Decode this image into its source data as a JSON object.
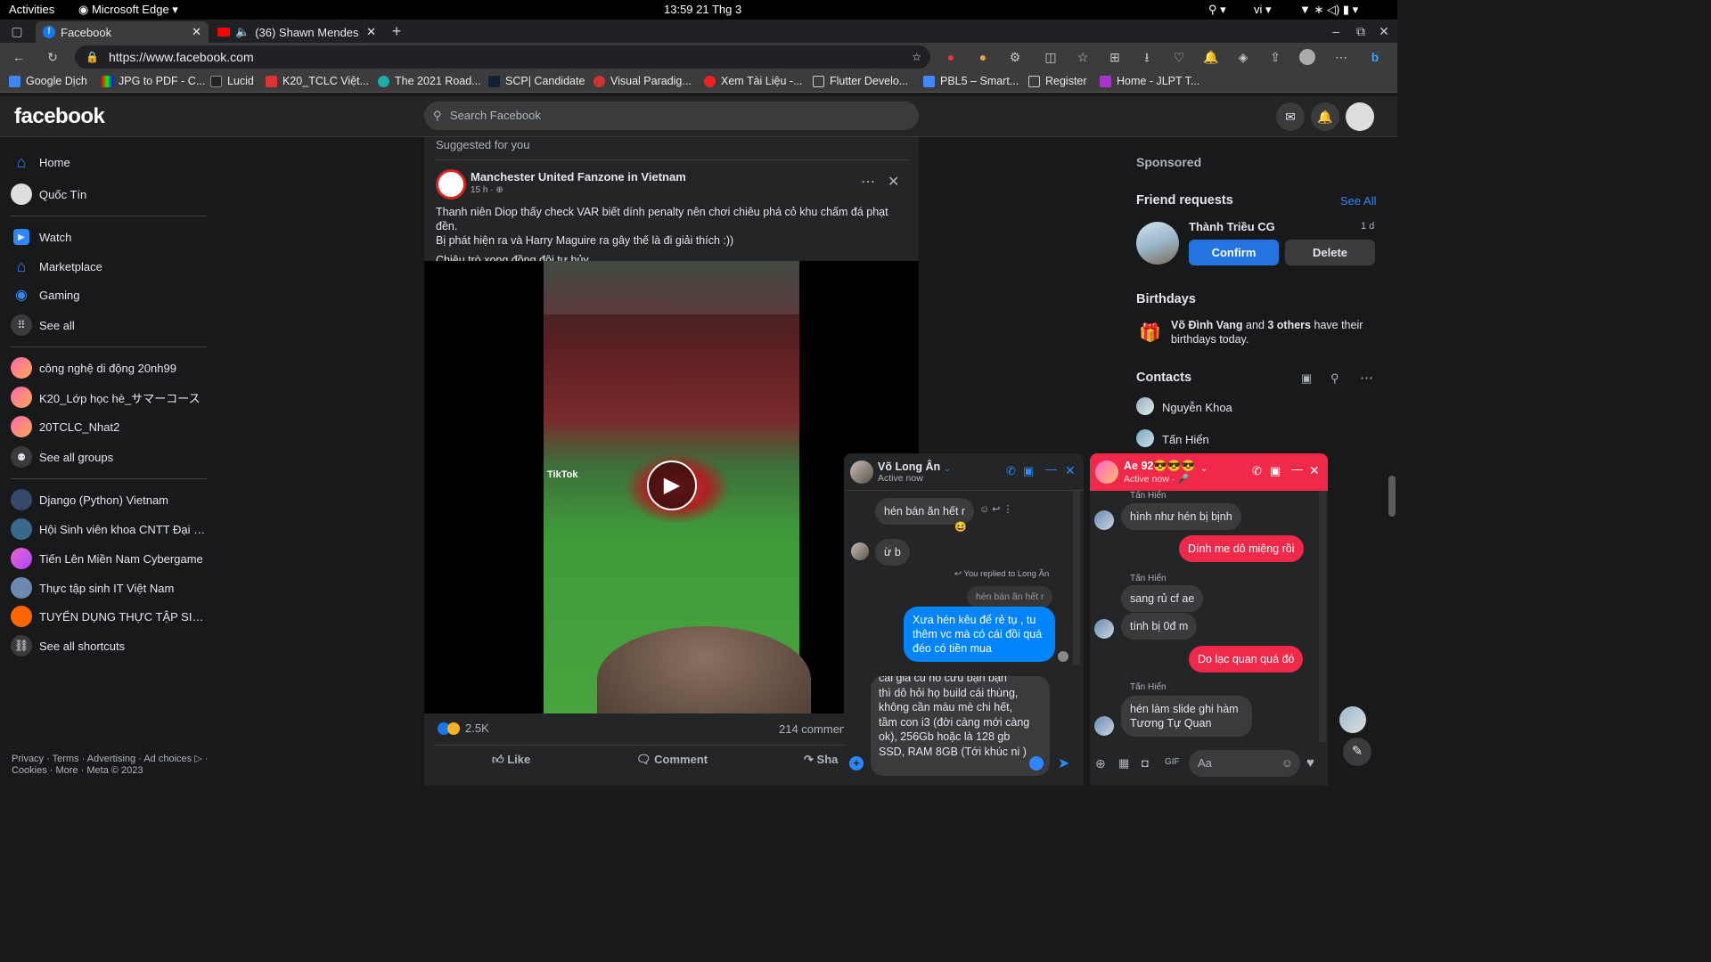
{
  "system": {
    "activities": "Activities",
    "app": "Microsoft Edge",
    "clock": "13:59  21 Thg 3",
    "lang": "vi"
  },
  "browser": {
    "tabs": [
      {
        "title": "Facebook"
      },
      {
        "title": "(36) Shawn Mendes - "
      }
    ],
    "url": "https://www.facebook.com",
    "bookmarks": [
      "Google Dịch",
      "JPG to PDF - C...",
      "Lucid",
      "K20_TCLC Việt...",
      "The 2021 Road...",
      "SCP| Candidate",
      "Visual Paradig...",
      "Xem Tài Liệu -...",
      "Flutter Develo...",
      "PBL5 – Smart...",
      "Register",
      "Home - JLPT T..."
    ]
  },
  "fb": {
    "logo": "facebook",
    "search_placeholder": "Search Facebook",
    "nav": [
      "Home",
      "Quốc Tín",
      "Watch",
      "Marketplace",
      "Gaming",
      "See all"
    ],
    "groups": [
      "công nghệ di động 20nh99",
      "K20_Lớp học hè_サマーコース",
      "20TCLC_Nhat2",
      "See all groups"
    ],
    "shortcuts": [
      "Django (Python) Vietnam",
      "Hội Sinh viên khoa CNTT Đại h...",
      "Tiến Lên Miền Nam Cybergame",
      "Thực tập sinh IT Việt Nam",
      "TUYỂN DỤNG THỰC TẬP SIN...",
      "See all shortcuts"
    ],
    "footer1": "Privacy · Terms · Advertising · Ad choices ▷ ·",
    "footer2": "Cookies · More · Meta © 2023"
  },
  "post": {
    "suggested": "Suggested for you",
    "page_name": "Manchester United Fanzone in Vietnam",
    "time": "15 h ·",
    "text1": "Thanh niên Diop thấy check VAR biết dính penalty nên chơi chiêu phá cỏ khu chấm đá phạt đền.",
    "text2": "Bị phát hiện ra và Harry Maguire ra gây thế là đi giải thích :))",
    "text3": "Chiêu trò xong đồng đội tự hủy.",
    "tiktok": "TikTok",
    "reactions": "2.5K",
    "comments": "214 comment",
    "like": "Like",
    "comment": "Comment",
    "share": "Sha"
  },
  "right": {
    "sponsored": "Sponsored",
    "friend_requests": "Friend requests",
    "see_all": "See All",
    "request_name": "Thành Triều CG",
    "request_time": "1 d",
    "confirm": "Confirm",
    "delete": "Delete",
    "birthdays": "Birthdays",
    "bday_name": "Võ Đình Vang",
    "bday_and": " and ",
    "bday_others": "3 others",
    "bday_rest": " have their birthdays today.",
    "contacts": "Contacts",
    "contact_list": [
      "Nguyễn Khoa",
      "Tấn Hiển"
    ]
  },
  "chat1": {
    "name": "Võ Long Ân",
    "status": "Active now",
    "msg1": "hén bán ăn hết r",
    "msg2": "ừ b",
    "replied": "You replied to Long Ân",
    "quoted": "hén bán ăn hết r",
    "msg3": "Xưa hén kêu để rẻ tụ , tu thêm vc mà có cái đồi quá đéo có tiền mua",
    "draft_top": "cái giá cũ nó cứu bạn bạn",
    "draft": "thì dô hỏi họ build cái thùng, không cần màu mè chi hết, tầm con i3 (đời càng mới càng ok), 256Gb hoặc là 128 gb SSD, RAM 8GB (Tới khúc ni )"
  },
  "chat2": {
    "name": "Ae 92😎😎😎",
    "status": "Active now · 🎤",
    "sender": "Tấn Hiển",
    "m1": "hình như hén bị bịnh",
    "m2": "Dính me dô miệng rồi",
    "m3": "sang rủ cf ae",
    "m4": "tính bị 0đ m",
    "m5": "Do lạc quan quá đó",
    "m6": "hén làm slide ghi hàm Tương Tự Quan",
    "input_placeholder": "Aa"
  }
}
